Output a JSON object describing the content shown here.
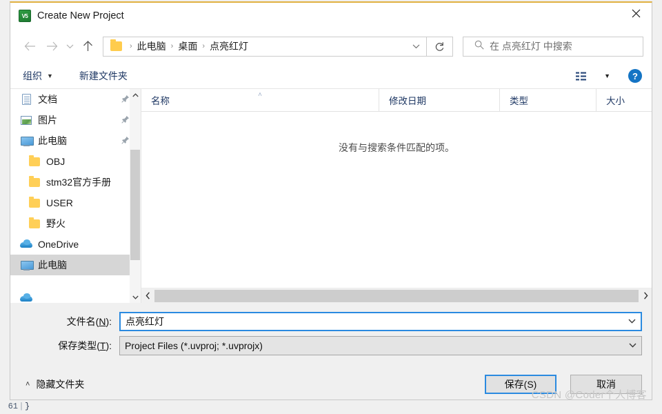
{
  "window": {
    "title": "Create New Project",
    "app_icon": "keil-uvision-icon",
    "close_label": "✕"
  },
  "nav": {
    "back_icon": "arrow-left-icon",
    "forward_icon": "arrow-right-icon",
    "recent_icon": "chevron-down-icon",
    "up_icon": "arrow-up-icon",
    "refresh_icon": "refresh-icon",
    "folder_icon": "folder-icon",
    "breadcrumb": [
      "此电脑",
      "桌面",
      "点亮红灯"
    ],
    "separator": "›",
    "dropdown_icon": "chevron-down-icon"
  },
  "search": {
    "icon": "search-icon",
    "placeholder": "在 点亮红灯 中搜索"
  },
  "toolbar": {
    "organize_label": "组织",
    "organize_caret": "▼",
    "new_folder_label": "新建文件夹",
    "view_icon": "list-view-icon",
    "view_caret": "▼",
    "help_label": "?"
  },
  "sidebar": {
    "scroll_up_icon": "chevron-up-icon",
    "scroll_down_icon": "chevron-down-icon",
    "items": [
      {
        "label": "文档",
        "icon": "document-icon",
        "pinned": true,
        "indent": false,
        "selected": false
      },
      {
        "label": "图片",
        "icon": "picture-icon",
        "pinned": true,
        "indent": false,
        "selected": false
      },
      {
        "label": "此电脑",
        "icon": "computer-icon",
        "pinned": true,
        "indent": false,
        "selected": false
      },
      {
        "label": "OBJ",
        "icon": "folder-icon",
        "pinned": false,
        "indent": true,
        "selected": false
      },
      {
        "label": "stm32官方手册",
        "icon": "folder-icon",
        "pinned": false,
        "indent": true,
        "selected": false
      },
      {
        "label": "USER",
        "icon": "folder-icon",
        "pinned": false,
        "indent": true,
        "selected": false
      },
      {
        "label": "野火",
        "icon": "folder-icon",
        "pinned": false,
        "indent": true,
        "selected": false
      },
      {
        "label": "OneDrive",
        "icon": "cloud-icon",
        "pinned": false,
        "indent": false,
        "selected": false
      },
      {
        "label": "此电脑",
        "icon": "computer-icon",
        "pinned": false,
        "indent": false,
        "selected": true
      }
    ]
  },
  "filelist": {
    "columns": [
      {
        "label": "名称",
        "sorted": true,
        "sort_caret": "˄"
      },
      {
        "label": "修改日期",
        "sorted": false
      },
      {
        "label": "类型",
        "sorted": false
      },
      {
        "label": "大小",
        "sorted": false
      }
    ],
    "rows": [],
    "empty_message": "没有与搜索条件匹配的项。",
    "hscroll_left_icon": "chevron-left-icon",
    "hscroll_right_icon": "chevron-right-icon"
  },
  "form": {
    "filename_label_prefix": "文件名(",
    "filename_label_key": "N",
    "filename_label_suffix": "):",
    "filename_value": "点亮红灯",
    "savetype_label_prefix": "保存类型(",
    "savetype_label_key": "T",
    "savetype_label_suffix": "):",
    "savetype_value": "Project Files (*.uvproj; *.uvprojx)",
    "combo_caret": "⌄"
  },
  "footer": {
    "hide_folders_caret": "˄",
    "hide_folders_label": "隐藏文件夹",
    "save_label": "保存(S)",
    "cancel_label": "取消"
  },
  "backdrop": {
    "code_line_number": "61",
    "code_separator": "|",
    "code_text": "}"
  },
  "watermark": {
    "text": "CSDN @Coder个人博客"
  },
  "colors": {
    "accent": "#2a8ae0",
    "titlebar_border": "#e0b040",
    "selection": "#d6d6d6",
    "link_text": "#1f3864",
    "help_blue": "#1474c4"
  }
}
